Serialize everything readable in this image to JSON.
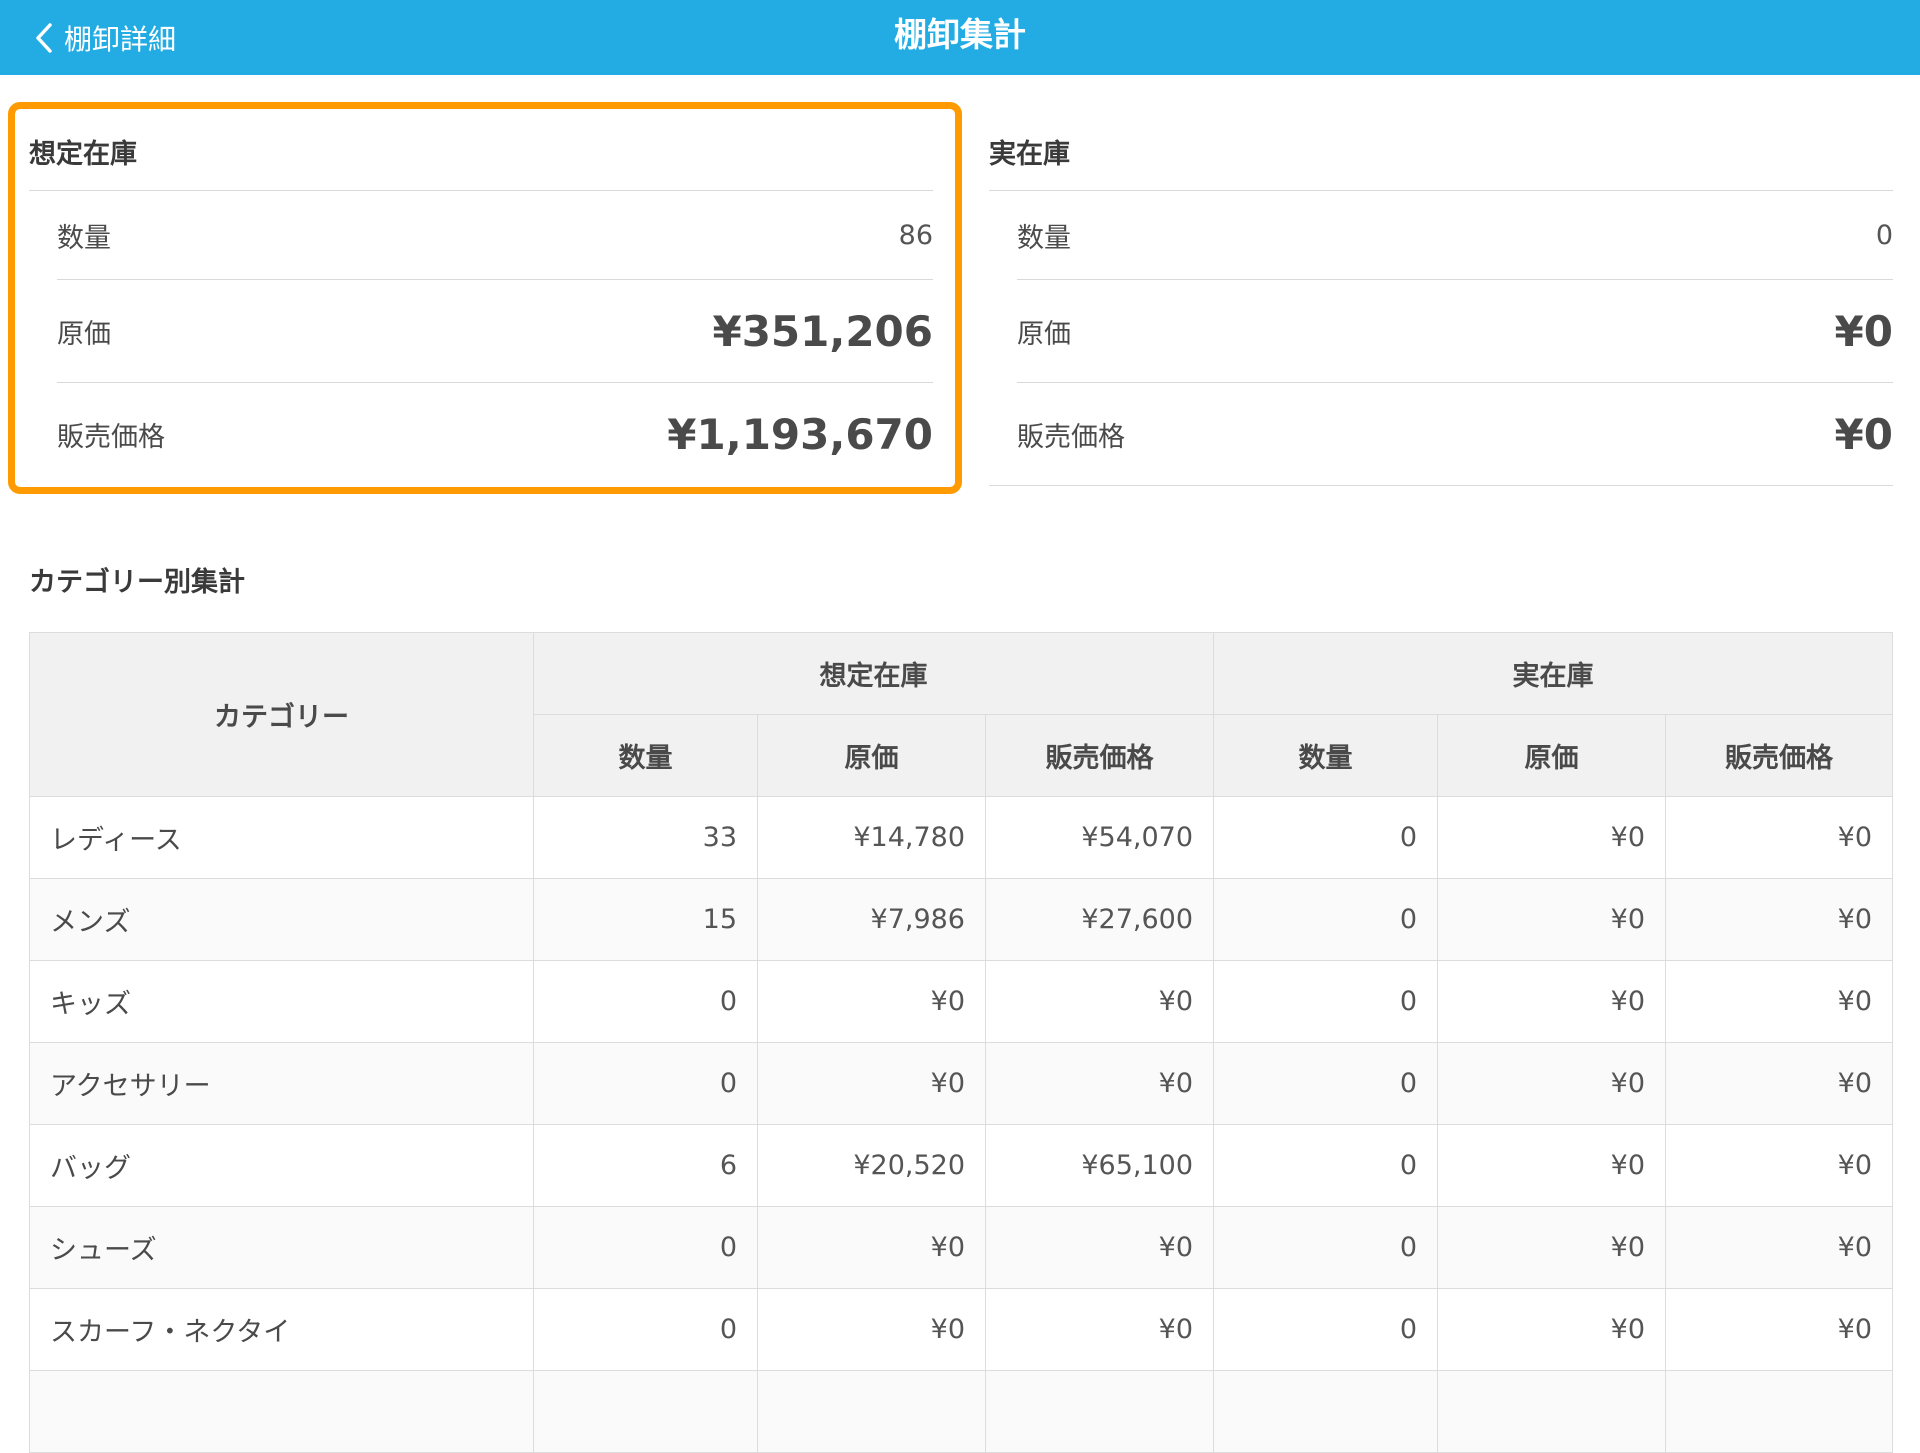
{
  "header": {
    "back_label": "棚卸詳細",
    "title": "棚卸集計"
  },
  "expected": {
    "title": "想定在庫",
    "qty_label": "数量",
    "qty": "86",
    "cost_label": "原価",
    "cost": "¥351,206",
    "price_label": "販売価格",
    "price": "¥1,193,670"
  },
  "actual": {
    "title": "実在庫",
    "qty_label": "数量",
    "qty": "0",
    "cost_label": "原価",
    "cost": "¥0",
    "price_label": "販売価格",
    "price": "¥0"
  },
  "category_section": {
    "title": "カテゴリー別集計"
  },
  "table": {
    "headers": {
      "category": "カテゴリー",
      "expected_group": "想定在庫",
      "actual_group": "実在庫",
      "qty": "数量",
      "cost": "原価",
      "price": "販売価格"
    },
    "rows": [
      {
        "name": "レディース",
        "e_qty": "33",
        "e_cost": "¥14,780",
        "e_price": "¥54,070",
        "a_qty": "0",
        "a_cost": "¥0",
        "a_price": "¥0"
      },
      {
        "name": "メンズ",
        "e_qty": "15",
        "e_cost": "¥7,986",
        "e_price": "¥27,600",
        "a_qty": "0",
        "a_cost": "¥0",
        "a_price": "¥0"
      },
      {
        "name": "キッズ",
        "e_qty": "0",
        "e_cost": "¥0",
        "e_price": "¥0",
        "a_qty": "0",
        "a_cost": "¥0",
        "a_price": "¥0"
      },
      {
        "name": "アクセサリー",
        "e_qty": "0",
        "e_cost": "¥0",
        "e_price": "¥0",
        "a_qty": "0",
        "a_cost": "¥0",
        "a_price": "¥0"
      },
      {
        "name": "バッグ",
        "e_qty": "6",
        "e_cost": "¥20,520",
        "e_price": "¥65,100",
        "a_qty": "0",
        "a_cost": "¥0",
        "a_price": "¥0"
      },
      {
        "name": "シューズ",
        "e_qty": "0",
        "e_cost": "¥0",
        "e_price": "¥0",
        "a_qty": "0",
        "a_cost": "¥0",
        "a_price": "¥0"
      },
      {
        "name": "スカーフ・ネクタイ",
        "e_qty": "0",
        "e_cost": "¥0",
        "e_price": "¥0",
        "a_qty": "0",
        "a_cost": "¥0",
        "a_price": "¥0"
      }
    ]
  },
  "colors": {
    "header_bg": "#22ace3",
    "highlight": "#ff9a00"
  }
}
